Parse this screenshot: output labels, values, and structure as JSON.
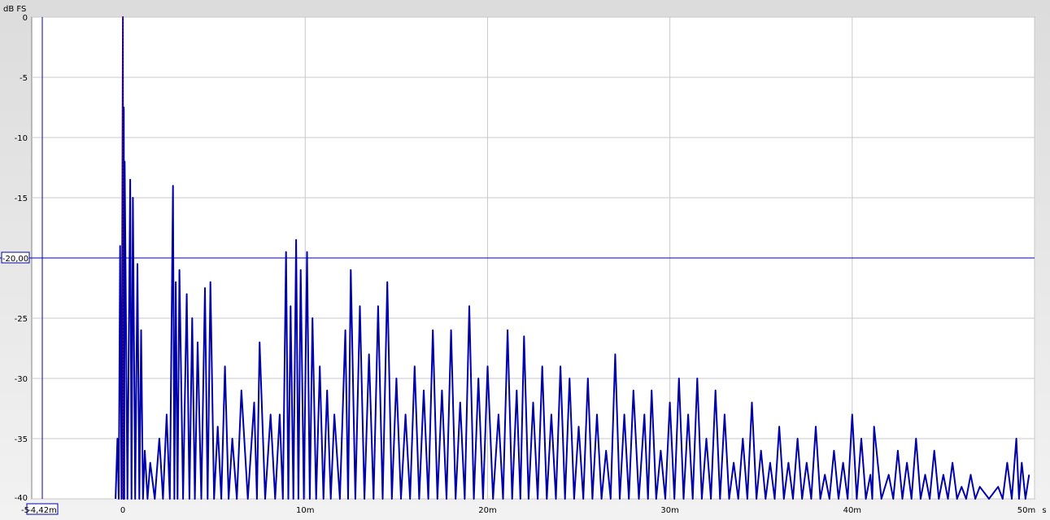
{
  "chart_data": {
    "type": "line",
    "title": "",
    "ylabel": "dB FS",
    "xlabel_unit": "s",
    "xlim_ms": [
      -5,
      50
    ],
    "ylim": [
      -40,
      0
    ],
    "grid": true,
    "x_ticks": [
      {
        "value": 0,
        "label": "0"
      },
      {
        "value": 10,
        "label": "10m"
      },
      {
        "value": 20,
        "label": "20m"
      },
      {
        "value": 30,
        "label": "30m"
      },
      {
        "value": 40,
        "label": "40m"
      },
      {
        "value": 50,
        "label": "50m"
      }
    ],
    "x_tick_left_label": "-5",
    "y_ticks": [
      {
        "value": 0,
        "label": "0"
      },
      {
        "value": -5,
        "label": "-5"
      },
      {
        "value": -10,
        "label": "-10"
      },
      {
        "value": -15,
        "label": "-15"
      },
      {
        "value": -20,
        "label": "-20"
      },
      {
        "value": -25,
        "label": "-25"
      },
      {
        "value": -30,
        "label": "-30"
      },
      {
        "value": -35,
        "label": "-35"
      },
      {
        "value": -40,
        "label": "-40"
      }
    ],
    "cursor": {
      "x_ms": -4.42,
      "x_label": "-4,42m",
      "y_db": -20,
      "y_label": "-20,00"
    },
    "series_color": "#0000aa",
    "impulse_marker_color": "#aa0000",
    "series": [
      {
        "name": "",
        "peaks": [
          {
            "x": -0.3,
            "y": -35
          },
          {
            "x": -0.15,
            "y": -19
          },
          {
            "x": 0.0,
            "y": 0
          },
          {
            "x": 0.05,
            "y": -7.5
          },
          {
            "x": 0.1,
            "y": -12
          },
          {
            "x": 0.4,
            "y": -13.5
          },
          {
            "x": 0.55,
            "y": -15
          },
          {
            "x": 0.8,
            "y": -20.5
          },
          {
            "x": 1.0,
            "y": -26
          },
          {
            "x": 1.2,
            "y": -36
          },
          {
            "x": 1.5,
            "y": -37
          },
          {
            "x": 2.0,
            "y": -35
          },
          {
            "x": 2.4,
            "y": -33
          },
          {
            "x": 2.75,
            "y": -14
          },
          {
            "x": 2.9,
            "y": -22
          },
          {
            "x": 3.1,
            "y": -21
          },
          {
            "x": 3.5,
            "y": -23
          },
          {
            "x": 3.8,
            "y": -25
          },
          {
            "x": 4.1,
            "y": -27
          },
          {
            "x": 4.5,
            "y": -22.5
          },
          {
            "x": 4.8,
            "y": -22
          },
          {
            "x": 5.2,
            "y": -34
          },
          {
            "x": 5.6,
            "y": -29
          },
          {
            "x": 6.0,
            "y": -35
          },
          {
            "x": 6.5,
            "y": -31
          },
          {
            "x": 7.2,
            "y": -32
          },
          {
            "x": 7.5,
            "y": -27
          },
          {
            "x": 8.1,
            "y": -33
          },
          {
            "x": 8.6,
            "y": -33
          },
          {
            "x": 8.95,
            "y": -19.5
          },
          {
            "x": 9.2,
            "y": -24
          },
          {
            "x": 9.5,
            "y": -18.5
          },
          {
            "x": 9.75,
            "y": -21
          },
          {
            "x": 10.1,
            "y": -19.5
          },
          {
            "x": 10.4,
            "y": -25
          },
          {
            "x": 10.8,
            "y": -29
          },
          {
            "x": 11.2,
            "y": -31
          },
          {
            "x": 11.6,
            "y": -33
          },
          {
            "x": 12.2,
            "y": -26
          },
          {
            "x": 12.5,
            "y": -21
          },
          {
            "x": 13.0,
            "y": -24
          },
          {
            "x": 13.5,
            "y": -28
          },
          {
            "x": 14.0,
            "y": -24
          },
          {
            "x": 14.5,
            "y": -22
          },
          {
            "x": 15.0,
            "y": -30
          },
          {
            "x": 15.5,
            "y": -33
          },
          {
            "x": 16.0,
            "y": -29
          },
          {
            "x": 16.5,
            "y": -31
          },
          {
            "x": 17.0,
            "y": -26
          },
          {
            "x": 17.5,
            "y": -31
          },
          {
            "x": 18.0,
            "y": -26
          },
          {
            "x": 18.5,
            "y": -32
          },
          {
            "x": 19.0,
            "y": -24
          },
          {
            "x": 19.5,
            "y": -30
          },
          {
            "x": 20.0,
            "y": -29
          },
          {
            "x": 20.6,
            "y": -33
          },
          {
            "x": 21.1,
            "y": -26
          },
          {
            "x": 21.6,
            "y": -31
          },
          {
            "x": 22.0,
            "y": -26.5
          },
          {
            "x": 22.5,
            "y": -32
          },
          {
            "x": 23.0,
            "y": -29
          },
          {
            "x": 23.5,
            "y": -33
          },
          {
            "x": 24.0,
            "y": -29
          },
          {
            "x": 24.5,
            "y": -30
          },
          {
            "x": 25.0,
            "y": -34
          },
          {
            "x": 25.5,
            "y": -30
          },
          {
            "x": 26.0,
            "y": -33
          },
          {
            "x": 26.5,
            "y": -36
          },
          {
            "x": 27.0,
            "y": -28
          },
          {
            "x": 27.5,
            "y": -33
          },
          {
            "x": 28.0,
            "y": -31
          },
          {
            "x": 28.6,
            "y": -33
          },
          {
            "x": 29.0,
            "y": -31
          },
          {
            "x": 29.5,
            "y": -36
          },
          {
            "x": 30.0,
            "y": -32
          },
          {
            "x": 30.5,
            "y": -30
          },
          {
            "x": 31.0,
            "y": -33
          },
          {
            "x": 31.5,
            "y": -30
          },
          {
            "x": 32.0,
            "y": -35
          },
          {
            "x": 32.5,
            "y": -31
          },
          {
            "x": 33.0,
            "y": -33
          },
          {
            "x": 33.5,
            "y": -37
          },
          {
            "x": 34.0,
            "y": -35
          },
          {
            "x": 34.5,
            "y": -32
          },
          {
            "x": 35.0,
            "y": -36
          },
          {
            "x": 35.5,
            "y": -37
          },
          {
            "x": 36.0,
            "y": -34
          },
          {
            "x": 36.5,
            "y": -37
          },
          {
            "x": 37.0,
            "y": -35
          },
          {
            "x": 37.5,
            "y": -37
          },
          {
            "x": 38.0,
            "y": -34
          },
          {
            "x": 38.5,
            "y": -38
          },
          {
            "x": 39.0,
            "y": -36
          },
          {
            "x": 39.5,
            "y": -37
          },
          {
            "x": 40.0,
            "y": -33
          },
          {
            "x": 40.5,
            "y": -35
          },
          {
            "x": 41.0,
            "y": -38
          },
          {
            "x": 41.2,
            "y": -34
          },
          {
            "x": 42.0,
            "y": -38
          },
          {
            "x": 42.5,
            "y": -36
          },
          {
            "x": 43.0,
            "y": -37
          },
          {
            "x": 43.5,
            "y": -35
          },
          {
            "x": 44.0,
            "y": -38
          },
          {
            "x": 44.5,
            "y": -36
          },
          {
            "x": 45.0,
            "y": -38
          },
          {
            "x": 45.5,
            "y": -37
          },
          {
            "x": 46.0,
            "y": -39
          },
          {
            "x": 46.5,
            "y": -38
          },
          {
            "x": 47.0,
            "y": -39
          },
          {
            "x": 48.0,
            "y": -39
          },
          {
            "x": 48.5,
            "y": -37
          },
          {
            "x": 49.0,
            "y": -35
          },
          {
            "x": 49.3,
            "y": -37
          },
          {
            "x": 49.7,
            "y": -38
          }
        ]
      }
    ]
  }
}
